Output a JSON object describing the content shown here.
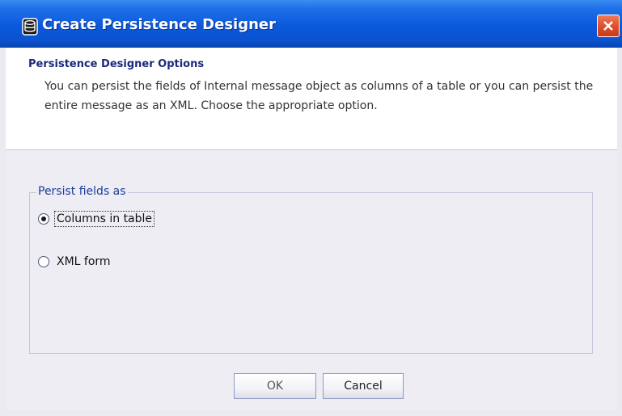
{
  "window": {
    "title": "Create Persistence Designer",
    "icon": "database-icon",
    "close_icon": "close-icon"
  },
  "header": {
    "title": "Persistence Designer Options",
    "description": "You can persist the fields of Internal message object as columns of a table or you can persist the entire message as an XML. Choose the appropriate option."
  },
  "group": {
    "legend": "Persist fields as",
    "options": [
      {
        "label": "Columns in table",
        "selected": true
      },
      {
        "label": "XML form",
        "selected": false
      }
    ]
  },
  "buttons": {
    "ok_label": "OK",
    "cancel_label": "Cancel"
  },
  "colors": {
    "titlebar": "#0b59db",
    "close_button": "#e0502e",
    "header_title": "#1a2a7a",
    "legend": "#1a3c9a"
  }
}
